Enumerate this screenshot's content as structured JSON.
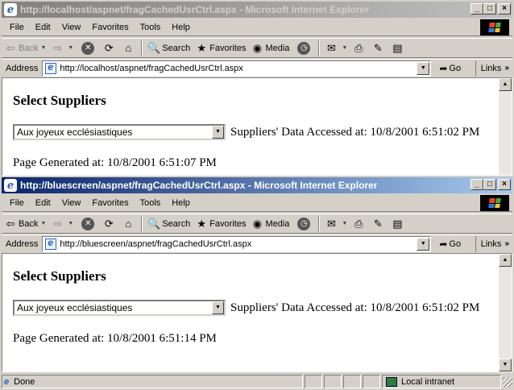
{
  "windows": [
    {
      "title": "http://localhost/aspnet/fragCachedUsrCtrl.aspx - Microsoft Internet Explorer",
      "address": "http://localhost/aspnet/fragCachedUsrCtrl.aspx",
      "page": {
        "heading": "Select Suppliers",
        "selected_supplier": "Aux joyeux ecclésiastiques",
        "accessed_text": "Suppliers' Data Accessed at: 10/8/2001 6:51:02 PM",
        "generated_text": "Page Generated at: 10/8/2001 6:51:07 PM"
      }
    },
    {
      "title": "http://bluescreen/aspnet/fragCachedUsrCtrl.aspx - Microsoft Internet Explorer",
      "address": "http://bluescreen/aspnet/fragCachedUsrCtrl.aspx",
      "page": {
        "heading": "Select Suppliers",
        "selected_supplier": "Aux joyeux ecclésiastiques",
        "accessed_text": "Suppliers' Data Accessed at: 10/8/2001 6:51:02 PM",
        "generated_text": "Page Generated at: 10/8/2001 6:51:14 PM"
      },
      "status": {
        "text": "Done",
        "zone": "Local intranet"
      }
    }
  ],
  "menu": [
    "File",
    "Edit",
    "View",
    "Favorites",
    "Tools",
    "Help"
  ],
  "toolbar": {
    "back": "Back",
    "search": "Search",
    "favorites": "Favorites",
    "media": "Media"
  },
  "address_label": "Address",
  "go_label": "Go",
  "links_label": "Links",
  "title_buttons": {
    "minimize": "_",
    "maximize": "□",
    "close": "×"
  }
}
